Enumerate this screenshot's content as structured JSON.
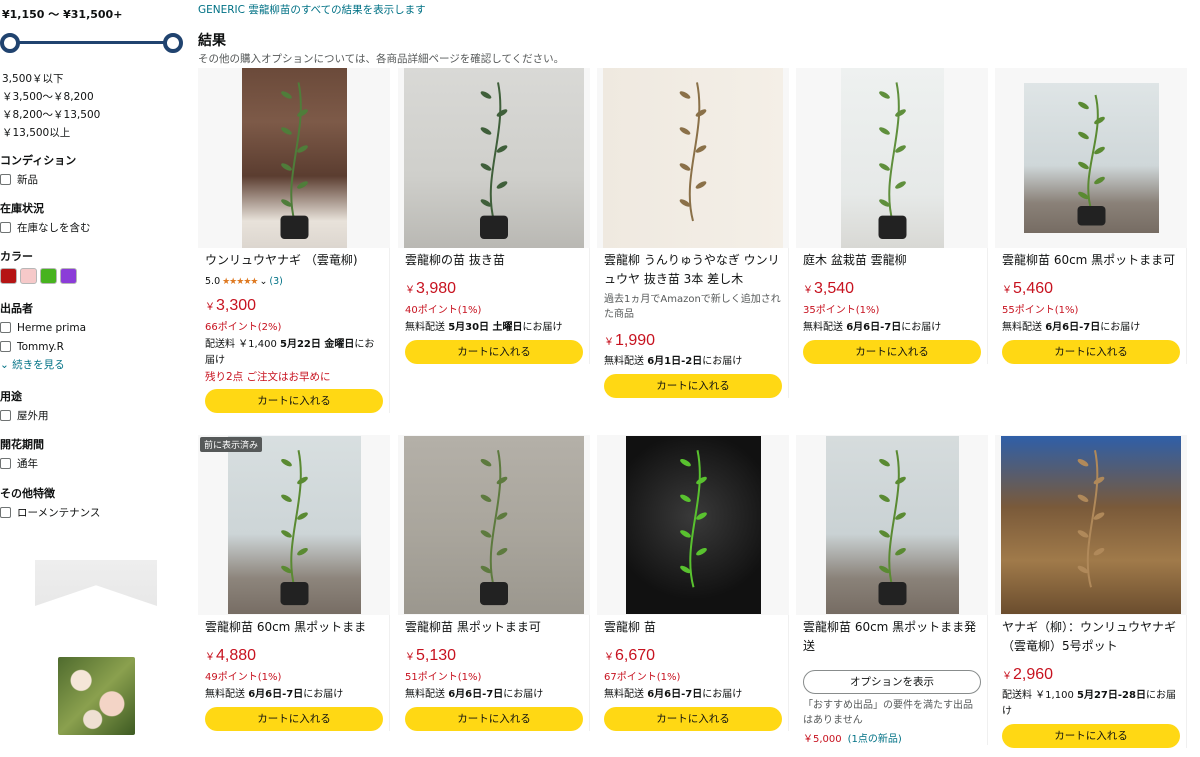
{
  "sidebar": {
    "price_range": "¥1,150 ～ ¥31,500+",
    "price_options": [
      "3,500￥以下",
      "￥3,500～￥8,200",
      "￥8,200～￥13,500",
      "￥13,500以上"
    ],
    "condition": {
      "heading": "コンディション",
      "option": "新品"
    },
    "availability": {
      "heading": "在庫状況",
      "option": "在庫なしを含む"
    },
    "color": {
      "heading": "カラー",
      "swatches": [
        "#b51414",
        "#f6c9c9",
        "#47b31f",
        "#8b3cd8"
      ]
    },
    "seller": {
      "heading": "出品者",
      "options": [
        "Herme prima",
        "Tommy.R"
      ],
      "more": "続きを見る"
    },
    "usage": {
      "heading": "用途",
      "option": "屋外用"
    },
    "bloom": {
      "heading": "開花期間",
      "option": "通年"
    },
    "other": {
      "heading": "その他特徴",
      "option": "ローメンテナンス"
    }
  },
  "header": {
    "note": "GENERIC 雲龍柳苗のすべての結果を表示します",
    "title": "結果",
    "subtitle": "その他の購入オプションについては、各商品詳細ページを確認してください。"
  },
  "cart_label": "カートに入れる",
  "products": [
    {
      "title": "ウンリュウヤナギ （雲竜柳)",
      "rating": "5.0",
      "stars": "★★★★★",
      "review_count": "(3)",
      "price": "3,300",
      "points": "66ポイント(2%)",
      "delivery_prefix": "配送料 ￥1,400",
      "delivery_date": "5月22日 金曜日",
      "delivery_suffix": "にお届け",
      "stock": "残り2点 ご注文はお早めに"
    },
    {
      "title": "雲龍柳の苗 抜き苗",
      "price": "3,980",
      "points": "40ポイント(1%)",
      "delivery_prefix": "無料配送",
      "delivery_date": "5月30日 土曜日",
      "delivery_suffix": "にお届け"
    },
    {
      "title": "雲龍柳 うんりゅうやなぎ ウンリュウヤ 抜き苗 3本 差し木",
      "note": "過去1ヵ月でAmazonで新しく追加された商品",
      "price": "1,990",
      "delivery_prefix": "無料配送",
      "delivery_date": "6月1日-2日",
      "delivery_suffix": "にお届け"
    },
    {
      "title": "庭木 盆栽苗 雲龍柳",
      "price": "3,540",
      "points": "35ポイント(1%)",
      "delivery_prefix": "無料配送",
      "delivery_date": "6月6日-7日",
      "delivery_suffix": "にお届け"
    },
    {
      "title": "雲龍柳苗 60cm 黒ポットまま可",
      "price": "5,460",
      "points": "55ポイント(1%)",
      "delivery_prefix": "無料配送",
      "delivery_date": "6月6日-7日",
      "delivery_suffix": "にお届け"
    },
    {
      "badge": "前に表示済み",
      "title": "雲龍柳苗 60cm 黒ポットまま",
      "price": "4,880",
      "points": "49ポイント(1%)",
      "delivery_prefix": "無料配送",
      "delivery_date": "6月6日-7日",
      "delivery_suffix": "にお届け"
    },
    {
      "title": "雲龍柳苗 黒ポットまま可",
      "price": "5,130",
      "points": "51ポイント(1%)",
      "delivery_prefix": "無料配送",
      "delivery_date": "6月6日-7日",
      "delivery_suffix": "にお届け"
    },
    {
      "title": "雲龍柳 苗",
      "price": "6,670",
      "points": "67ポイント(1%)",
      "delivery_prefix": "無料配送",
      "delivery_date": "6月6日-7日",
      "delivery_suffix": "にお届け"
    },
    {
      "title": "雲龍柳苗 60cm 黒ポットまま発送",
      "options_label": "オプションを表示",
      "rec_note": "「おすすめ出品」の要件を満たす出品はありません",
      "rec_price": "￥5,000",
      "rec_link": "(1点の新品)"
    },
    {
      "title": "ヤナギ（柳）：ウンリュウヤナギ（雲竜柳）5号ポット",
      "price": "2,960",
      "delivery_prefix": "配送料 ￥1,100",
      "delivery_date": "5月27日-28日",
      "delivery_suffix": "にお届け"
    }
  ]
}
